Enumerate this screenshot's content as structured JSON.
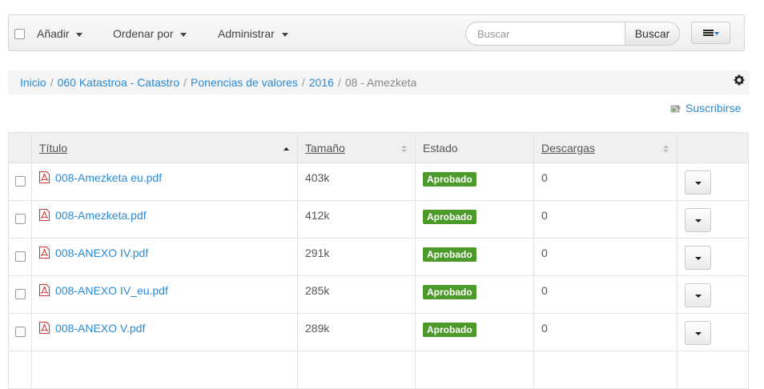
{
  "toolbar": {
    "add_label": "Añadir",
    "sort_label": "Ordenar por",
    "manage_label": "Administrar",
    "search_placeholder": "Buscar",
    "search_button": "Buscar"
  },
  "breadcrumb": {
    "items": [
      "Inicio",
      "060 Katastroa - Catastro",
      "Ponencias de valores",
      "2016"
    ],
    "current": "08 - Amezketa",
    "separator": "/"
  },
  "subscribe_label": "Suscribirse",
  "table": {
    "columns": {
      "title": "Título",
      "size": "Tamaño",
      "status": "Estado",
      "downloads": "Descargas"
    },
    "rows": [
      {
        "title": "008-Amezketa eu.pdf",
        "size": "403k",
        "status": "Aprobado",
        "downloads": "0"
      },
      {
        "title": "008-Amezketa.pdf",
        "size": "412k",
        "status": "Aprobado",
        "downloads": "0"
      },
      {
        "title": "008-ANEXO IV.pdf",
        "size": "291k",
        "status": "Aprobado",
        "downloads": "0"
      },
      {
        "title": "008-ANEXO IV_eu.pdf",
        "size": "285k",
        "status": "Aprobado",
        "downloads": "0"
      },
      {
        "title": "008-ANEXO V.pdf",
        "size": "289k",
        "status": "Aprobado",
        "downloads": "0"
      }
    ]
  },
  "colors": {
    "link": "#2a8ad3",
    "approved_badge": "#4c9a2a",
    "header_bg": "#f0f0f0"
  },
  "icons": {
    "file_type": "pdf-icon",
    "settings": "gear-icon",
    "subscribe": "rss-icon",
    "view_toggle": "list-view-icon"
  }
}
